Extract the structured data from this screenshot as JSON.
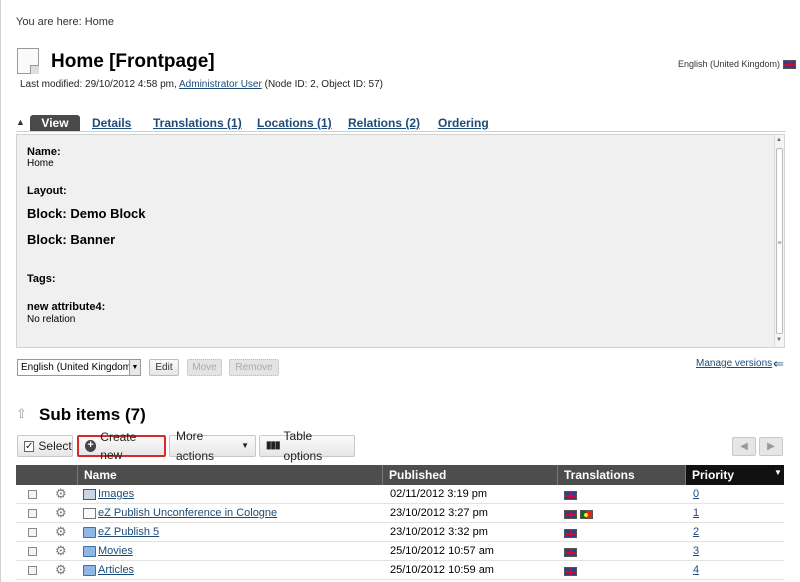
{
  "breadcrumb": {
    "text": "You are here: Home"
  },
  "header": {
    "title": "Home [Frontpage]",
    "meta_prefix": "Last modified: 29/10/2012 4:58 pm,",
    "meta_user": "Administrator User",
    "meta_suffix": "(Node ID: 2, Object ID: 57)",
    "language": "English (United Kingdom)"
  },
  "tabs": {
    "toggle": "▲",
    "active": "View",
    "items": [
      "Details",
      "Translations (1)",
      "Locations (1)",
      "Relations (2)",
      "Ordering"
    ]
  },
  "view": {
    "name_label": "Name:",
    "name_value": "Home",
    "layout_label": "Layout:",
    "block1": "Block: Demo Block",
    "block2": "Block: Banner",
    "tags_label": "Tags:",
    "attr_label": "new attribute4:",
    "attr_value": "No relation"
  },
  "language_bar": {
    "selected": "English (United Kingdom)",
    "edit": "Edit",
    "move": "Move",
    "remove": "Remove",
    "manage_versions": "Manage versions"
  },
  "sub_items": {
    "title": "Sub items (7)",
    "toolbar": {
      "select": "Select",
      "create_new": "Create new",
      "more_actions": "More actions",
      "table_options": "Table options"
    },
    "columns": {
      "name": "Name",
      "published": "Published",
      "translations": "Translations",
      "priority": "Priority"
    },
    "rows": [
      {
        "icon": "image-icon",
        "name": "Images",
        "published": "02/11/2012 3:19 pm",
        "flags": [
          "uk-flag"
        ],
        "priority": "0"
      },
      {
        "icon": "document-icon",
        "name": "eZ Publish Unconference in Cologne",
        "published": "23/10/2012 3:27 pm",
        "flags": [
          "uk-flag",
          "portugal-flag"
        ],
        "priority": "1"
      },
      {
        "icon": "folder-icon",
        "name": "eZ Publish 5",
        "published": "23/10/2012 3:32 pm",
        "flags": [
          "uk-flag"
        ],
        "priority": "2"
      },
      {
        "icon": "folder-icon",
        "name": "Movies",
        "published": "25/10/2012 10:57 am",
        "flags": [
          "uk-flag"
        ],
        "priority": "3"
      },
      {
        "icon": "folder-icon",
        "name": "Articles",
        "published": "25/10/2012 10:59 am",
        "flags": [
          "uk-flag"
        ],
        "priority": "4"
      }
    ]
  },
  "colors": {
    "link": "#1c4b7a",
    "header_bg": "#4d4d4d",
    "priority_header_bg": "#111111",
    "create_border": "#d52b2b"
  }
}
